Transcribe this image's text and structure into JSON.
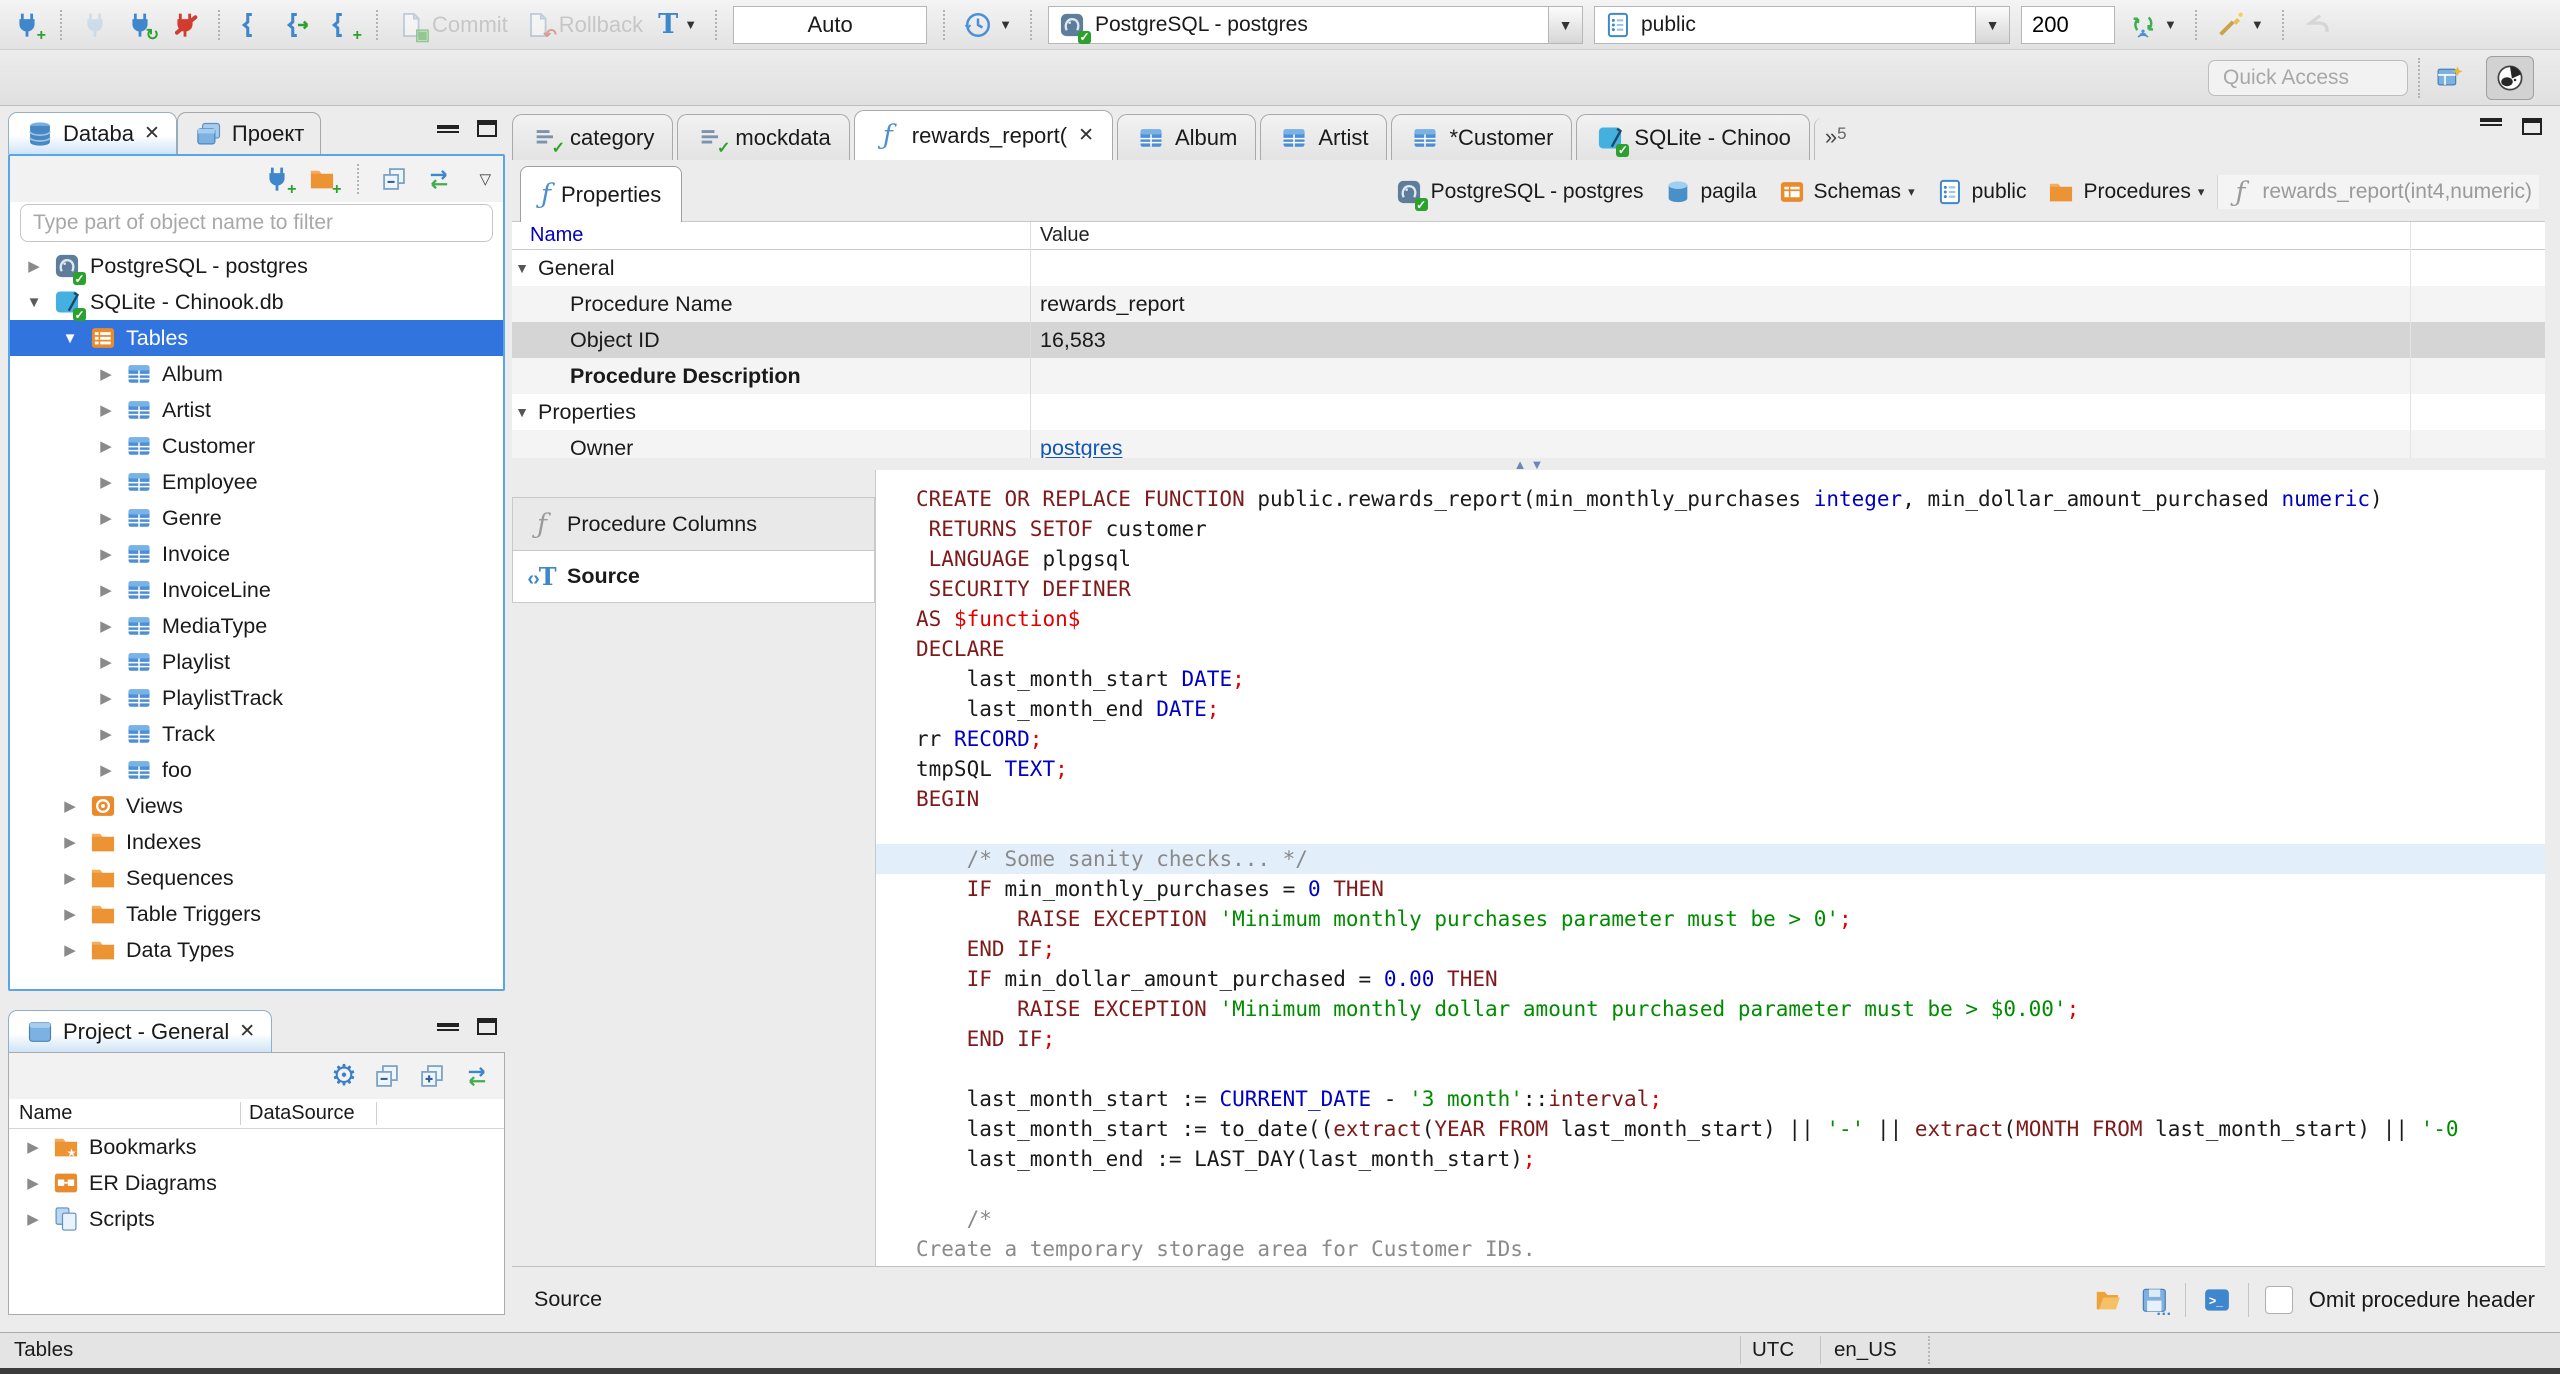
{
  "toolbar": {
    "commit_label": "Commit",
    "rollback_label": "Rollback",
    "auto_label": "Auto",
    "connection_value": "PostgreSQL - postgres",
    "schema_value": "public",
    "fetch_size_value": "200",
    "quick_access_placeholder": "Quick Access"
  },
  "navigator": {
    "tabs": [
      {
        "label": "Databa",
        "icon": "db-navigator",
        "active": true,
        "closable": true
      },
      {
        "label": "Проект",
        "icon": "projects",
        "active": false,
        "closable": false
      }
    ],
    "filter_placeholder": "Type part of object name to filter",
    "tree": [
      {
        "depth": 0,
        "state": "collapsed",
        "icon": "postgres",
        "label": "PostgreSQL - postgres"
      },
      {
        "depth": 0,
        "state": "expanded",
        "icon": "sqlite",
        "label": "SQLite - Chinook.db"
      },
      {
        "depth": 1,
        "state": "expanded",
        "icon": "tables-folder",
        "label": "Tables",
        "selected": true
      },
      {
        "depth": 2,
        "state": "collapsed",
        "icon": "table",
        "label": "Album"
      },
      {
        "depth": 2,
        "state": "collapsed",
        "icon": "table",
        "label": "Artist"
      },
      {
        "depth": 2,
        "state": "collapsed",
        "icon": "table",
        "label": "Customer"
      },
      {
        "depth": 2,
        "state": "collapsed",
        "icon": "table",
        "label": "Employee"
      },
      {
        "depth": 2,
        "state": "collapsed",
        "icon": "table",
        "label": "Genre"
      },
      {
        "depth": 2,
        "state": "collapsed",
        "icon": "table",
        "label": "Invoice"
      },
      {
        "depth": 2,
        "state": "collapsed",
        "icon": "table",
        "label": "InvoiceLine"
      },
      {
        "depth": 2,
        "state": "collapsed",
        "icon": "table",
        "label": "MediaType"
      },
      {
        "depth": 2,
        "state": "collapsed",
        "icon": "table",
        "label": "Playlist"
      },
      {
        "depth": 2,
        "state": "collapsed",
        "icon": "table",
        "label": "PlaylistTrack"
      },
      {
        "depth": 2,
        "state": "collapsed",
        "icon": "table",
        "label": "Track"
      },
      {
        "depth": 2,
        "state": "collapsed",
        "icon": "table",
        "label": "foo"
      },
      {
        "depth": 1,
        "state": "collapsed",
        "icon": "views",
        "label": "Views"
      },
      {
        "depth": 1,
        "state": "collapsed",
        "icon": "folder",
        "label": "Indexes"
      },
      {
        "depth": 1,
        "state": "collapsed",
        "icon": "folder",
        "label": "Sequences"
      },
      {
        "depth": 1,
        "state": "collapsed",
        "icon": "folder",
        "label": "Table Triggers"
      },
      {
        "depth": 1,
        "state": "collapsed",
        "icon": "folder",
        "label": "Data Types"
      }
    ]
  },
  "project_panel": {
    "title": "Project - General",
    "columns": [
      "Name",
      "DataSource"
    ],
    "rows": [
      {
        "icon": "bookmarks-folder",
        "label": "Bookmarks"
      },
      {
        "icon": "er-diagrams",
        "label": "ER Diagrams"
      },
      {
        "icon": "scripts",
        "label": "Scripts"
      }
    ]
  },
  "editor": {
    "tabs": [
      {
        "label": "category",
        "icon": "sql-script",
        "active": false,
        "closable": false
      },
      {
        "label": "mockdata",
        "icon": "sql-script",
        "active": false,
        "closable": false
      },
      {
        "label": "rewards_report(",
        "icon": "function",
        "active": true,
        "closable": true
      },
      {
        "label": "Album",
        "icon": "table",
        "active": false,
        "closable": false
      },
      {
        "label": "Artist",
        "icon": "table",
        "active": false,
        "closable": false
      },
      {
        "label": "*Customer",
        "icon": "table",
        "active": false,
        "closable": false
      },
      {
        "label": "SQLite - Chinoo",
        "icon": "sqlite",
        "active": false,
        "closable": false
      }
    ],
    "overflow_count": "5",
    "properties_tab_label": "Properties",
    "breadcrumb": [
      {
        "icon": "postgres",
        "label": "PostgreSQL - postgres",
        "dropdown": false,
        "dim": false
      },
      {
        "icon": "database",
        "label": "pagila",
        "dropdown": false,
        "dim": false
      },
      {
        "icon": "schemas-folder",
        "label": "Schemas",
        "dropdown": true,
        "dim": false
      },
      {
        "icon": "schema",
        "label": "public",
        "dropdown": false,
        "dim": false
      },
      {
        "icon": "folder",
        "label": "Procedures",
        "dropdown": true,
        "dim": false
      },
      {
        "icon": "function-gray",
        "label": "rewards_report(int4,numeric)",
        "dropdown": false,
        "dim": true
      }
    ],
    "props_grid": {
      "columns": [
        "Name",
        "Value"
      ],
      "rows": [
        {
          "type": "group",
          "name": "General",
          "value": ""
        },
        {
          "type": "prop",
          "name": "Procedure Name",
          "value": "rewards_report"
        },
        {
          "type": "prop",
          "name": "Object ID",
          "value": "16,583",
          "selected": true
        },
        {
          "type": "prop",
          "name": "Procedure Description",
          "value": "",
          "bold": true
        },
        {
          "type": "group",
          "name": "Properties",
          "value": ""
        },
        {
          "type": "prop",
          "name": "Owner",
          "value": "postgres",
          "link": true
        }
      ]
    },
    "subtabs": [
      {
        "label": "Procedure Columns",
        "icon": "function-gray",
        "active": false
      },
      {
        "label": "Source",
        "icon": "source-text",
        "active": true
      }
    ],
    "footer": {
      "label": "Source",
      "omit_label": "Omit procedure header",
      "omit_checked": false
    },
    "code_lines": [
      {
        "seg": [
          [
            "k",
            "CREATE OR REPLACE FUNCTION"
          ],
          [
            "p",
            " public.rewards_report(min_monthly_purchases "
          ],
          [
            "t",
            "integer"
          ],
          [
            "p",
            ", min_dollar_amount_purchased "
          ],
          [
            "t",
            "numeric"
          ],
          [
            "p",
            ")"
          ]
        ]
      },
      {
        "seg": [
          [
            "p",
            " "
          ],
          [
            "k",
            "RETURNS SETOF"
          ],
          [
            "p",
            " customer"
          ]
        ]
      },
      {
        "seg": [
          [
            "p",
            " "
          ],
          [
            "k",
            "LANGUAGE"
          ],
          [
            "p",
            " plpgsql"
          ]
        ]
      },
      {
        "seg": [
          [
            "p",
            " "
          ],
          [
            "k",
            "SECURITY DEFINER"
          ]
        ]
      },
      {
        "seg": [
          [
            "k",
            "AS"
          ],
          [
            "p",
            " "
          ],
          [
            "r",
            "$function$"
          ]
        ]
      },
      {
        "seg": [
          [
            "k",
            "DECLARE"
          ]
        ]
      },
      {
        "seg": [
          [
            "p",
            "    last_month_start "
          ],
          [
            "t",
            "DATE"
          ],
          [
            "r",
            ";"
          ]
        ]
      },
      {
        "seg": [
          [
            "p",
            "    last_month_end "
          ],
          [
            "t",
            "DATE"
          ],
          [
            "r",
            ";"
          ]
        ]
      },
      {
        "seg": [
          [
            "p",
            "rr "
          ],
          [
            "t",
            "RECORD"
          ],
          [
            "r",
            ";"
          ]
        ]
      },
      {
        "seg": [
          [
            "p",
            "tmpSQL "
          ],
          [
            "t",
            "TEXT"
          ],
          [
            "r",
            ";"
          ]
        ]
      },
      {
        "seg": [
          [
            "k",
            "BEGIN"
          ]
        ]
      },
      {
        "seg": []
      },
      {
        "hl": true,
        "seg": [
          [
            "p",
            "    "
          ],
          [
            "c",
            "/* Some sanity checks... */"
          ]
        ]
      },
      {
        "seg": [
          [
            "p",
            "    "
          ],
          [
            "k",
            "IF"
          ],
          [
            "p",
            " min_monthly_purchases = "
          ],
          [
            "n",
            "0"
          ],
          [
            "p",
            " "
          ],
          [
            "k",
            "THEN"
          ]
        ]
      },
      {
        "seg": [
          [
            "p",
            "        "
          ],
          [
            "k",
            "RAISE EXCEPTION"
          ],
          [
            "p",
            " "
          ],
          [
            "s",
            "'Minimum monthly purchases parameter must be > 0'"
          ],
          [
            "r",
            ";"
          ]
        ]
      },
      {
        "seg": [
          [
            "p",
            "    "
          ],
          [
            "k",
            "END IF"
          ],
          [
            "r",
            ";"
          ]
        ]
      },
      {
        "seg": [
          [
            "p",
            "    "
          ],
          [
            "k",
            "IF"
          ],
          [
            "p",
            " min_dollar_amount_purchased = "
          ],
          [
            "n",
            "0.00"
          ],
          [
            "p",
            " "
          ],
          [
            "k",
            "THEN"
          ]
        ]
      },
      {
        "seg": [
          [
            "p",
            "        "
          ],
          [
            "k",
            "RAISE EXCEPTION"
          ],
          [
            "p",
            " "
          ],
          [
            "s",
            "'Minimum monthly dollar amount purchased parameter must be > $0.00'"
          ],
          [
            "r",
            ";"
          ]
        ]
      },
      {
        "seg": [
          [
            "p",
            "    "
          ],
          [
            "k",
            "END IF"
          ],
          [
            "r",
            ";"
          ]
        ]
      },
      {
        "seg": []
      },
      {
        "seg": [
          [
            "p",
            "    last_month_start := "
          ],
          [
            "t",
            "CURRENT_DATE"
          ],
          [
            "p",
            " - "
          ],
          [
            "s",
            "'3 month'"
          ],
          [
            "p",
            "::"
          ],
          [
            "k",
            "interval"
          ],
          [
            "r",
            ";"
          ]
        ]
      },
      {
        "seg": [
          [
            "p",
            "    last_month_start := to_date(("
          ],
          [
            "k",
            "extract"
          ],
          [
            "p",
            "("
          ],
          [
            "k",
            "YEAR FROM"
          ],
          [
            "p",
            " last_month_start) || "
          ],
          [
            "s",
            "'-'"
          ],
          [
            "p",
            " || "
          ],
          [
            "k",
            "extract"
          ],
          [
            "p",
            "("
          ],
          [
            "k",
            "MONTH FROM"
          ],
          [
            "p",
            " last_month_start) || "
          ],
          [
            "s",
            "'-0"
          ]
        ]
      },
      {
        "seg": [
          [
            "p",
            "    last_month_end := LAST_DAY(last_month_start)"
          ],
          [
            "r",
            ";"
          ]
        ]
      },
      {
        "seg": []
      },
      {
        "seg": [
          [
            "p",
            "    "
          ],
          [
            "c",
            "/*"
          ]
        ]
      },
      {
        "seg": [
          [
            "c",
            "Create a temporary storage area for Customer IDs."
          ]
        ]
      },
      {
        "seg": [
          [
            "c",
            "*/"
          ]
        ]
      }
    ]
  },
  "statusbar": {
    "left": "Tables",
    "timezone": "UTC",
    "locale": "en_US"
  }
}
